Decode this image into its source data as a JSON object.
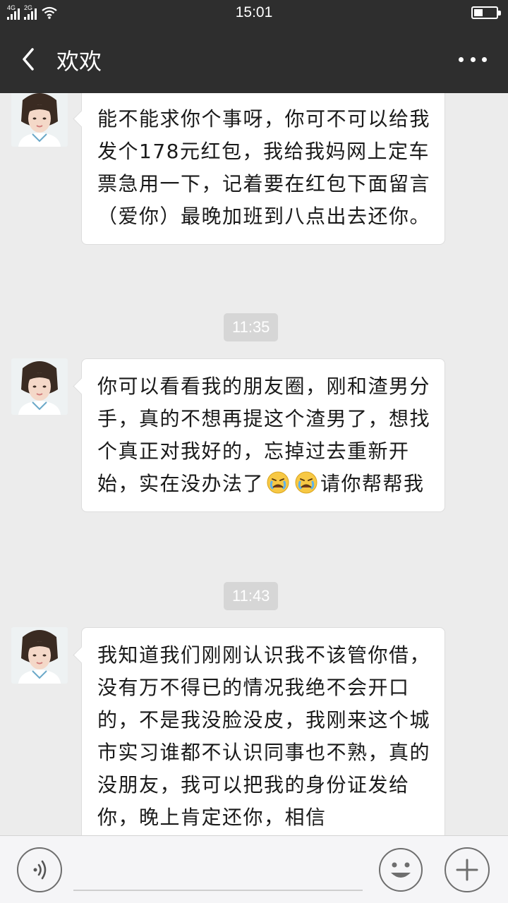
{
  "status_bar": {
    "network_1": "4G",
    "network_2": "2G",
    "time": "15:01",
    "battery_level": 0.4
  },
  "header": {
    "back_icon": "chevron-left-icon",
    "title": "欢欢",
    "more_icon": "more-dots-icon"
  },
  "messages": [
    {
      "text_parts": [
        "能不能求你个事呀，你可不可以给我发个178元红包，我给我妈网上定车票急用一下，记着要在红包下面留言（爱你）最晚加班到八点出去还你。"
      ]
    },
    {
      "time_label": "11:35",
      "text_parts": [
        "你可以看看我的朋友圈，刚和渣男分手，真的不想再提这个渣男了，想找个真正对我好的，忘掉过去重新开始，实在没办法了",
        "请你帮帮我"
      ],
      "emojis": [
        "crying-face-icon",
        "crying-face-icon"
      ]
    },
    {
      "time_label": "11:43",
      "text_parts": [
        "我知道我们刚刚认识我不该管你借，没有万不得已的情况我绝不会开口的，不是我没脸没皮，我刚来这个城市实习谁都不认识同事也不熟，真的没朋友，我可以把我的身份证发给你，晚上肯定还你，相信"
      ]
    }
  ],
  "input_bar": {
    "voice_icon": "voice-icon",
    "emoji_icon": "emoji-icon",
    "plus_icon": "plus-icon"
  },
  "colors": {
    "header_bg": "#2e2e2e",
    "chat_bg": "#ececec",
    "bubble_bg": "#ffffff",
    "time_label_bg": "#d6d6d6"
  }
}
